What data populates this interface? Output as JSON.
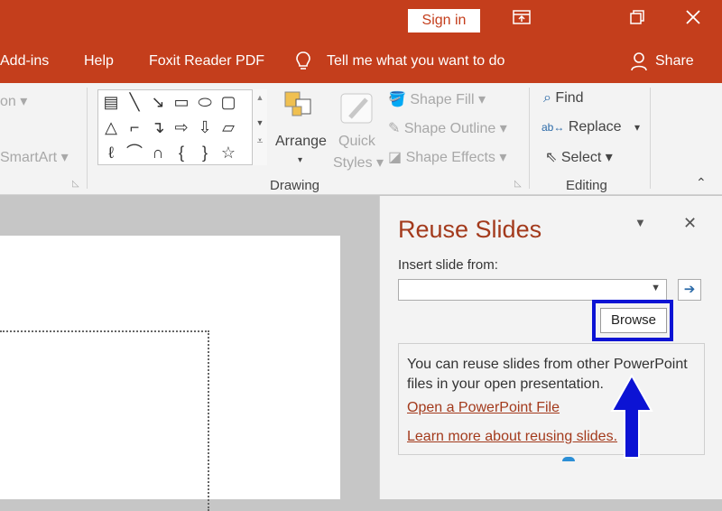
{
  "titlebar": {
    "sign_in_label": "Sign in",
    "ribbon_display_icon": "ribbon-display-options-icon",
    "restore_icon": "restore-icon",
    "close_icon": "close-icon",
    "color": "#c43e1c"
  },
  "menubar": {
    "items": [
      "Add-ins",
      "Help",
      "Foxit Reader PDF"
    ],
    "tell_me": "Tell me what you want to do",
    "share": "Share"
  },
  "ribbon": {
    "partial_left_top": "on",
    "partial_left_bottom": "SmartArt",
    "drawing": {
      "arrange_label": "Arrange",
      "quick_styles_label_1": "Quick",
      "quick_styles_label_2": "Styles",
      "shape_fill": "Shape Fill",
      "shape_outline": "Shape Outline",
      "shape_effects": "Shape Effects",
      "group_label": "Drawing"
    },
    "editing": {
      "find": "Find",
      "replace": "Replace",
      "select": "Select",
      "group_label": "Editing"
    }
  },
  "reuse_pane": {
    "title": "Reuse Slides",
    "insert_label": "Insert slide from:",
    "combo_value": "",
    "browse_label": "Browse",
    "info_text": "You can reuse slides from other PowerPoint files in your open presentation.",
    "open_link": "Open a PowerPoint File",
    "learn_link": "Learn more about reusing slides.",
    "highlight_color": "#0c13d4"
  }
}
